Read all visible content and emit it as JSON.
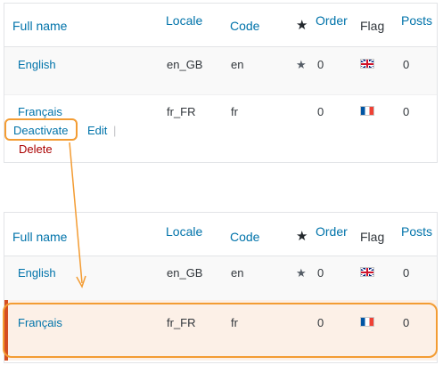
{
  "columns": {
    "full_name": "Full name",
    "locale": "Locale",
    "code": "Code",
    "order": "Order",
    "flag": "Flag",
    "posts": "Posts"
  },
  "icons": {
    "star": "star-icon",
    "flag_gb": "flag-gb-icon",
    "flag_fr": "flag-fr-icon"
  },
  "before": {
    "rows": [
      {
        "name": "English",
        "locale": "en_GB",
        "code": "en",
        "order": "0",
        "posts": "0",
        "default": true
      },
      {
        "name": "Français",
        "locale": "fr_FR",
        "code": "fr",
        "order": "0",
        "posts": "0",
        "default": false
      }
    ],
    "row_actions": {
      "deactivate": "Deactivate",
      "edit": "Edit",
      "separator": "|",
      "delete": "Delete"
    }
  },
  "after": {
    "rows": [
      {
        "name": "English",
        "locale": "en_GB",
        "code": "en",
        "order": "0",
        "posts": "0",
        "default": true
      },
      {
        "name": "Français",
        "locale": "fr_FR",
        "code": "fr",
        "order": "0",
        "posts": "0",
        "default": false,
        "status": "inactive"
      }
    ]
  },
  "colors": {
    "link": "#0073aa",
    "delete": "#aa0000",
    "callout": "#f39c33",
    "inactive_marker": "#d54e21",
    "inactive_row_bg": "#fcf0e7"
  }
}
